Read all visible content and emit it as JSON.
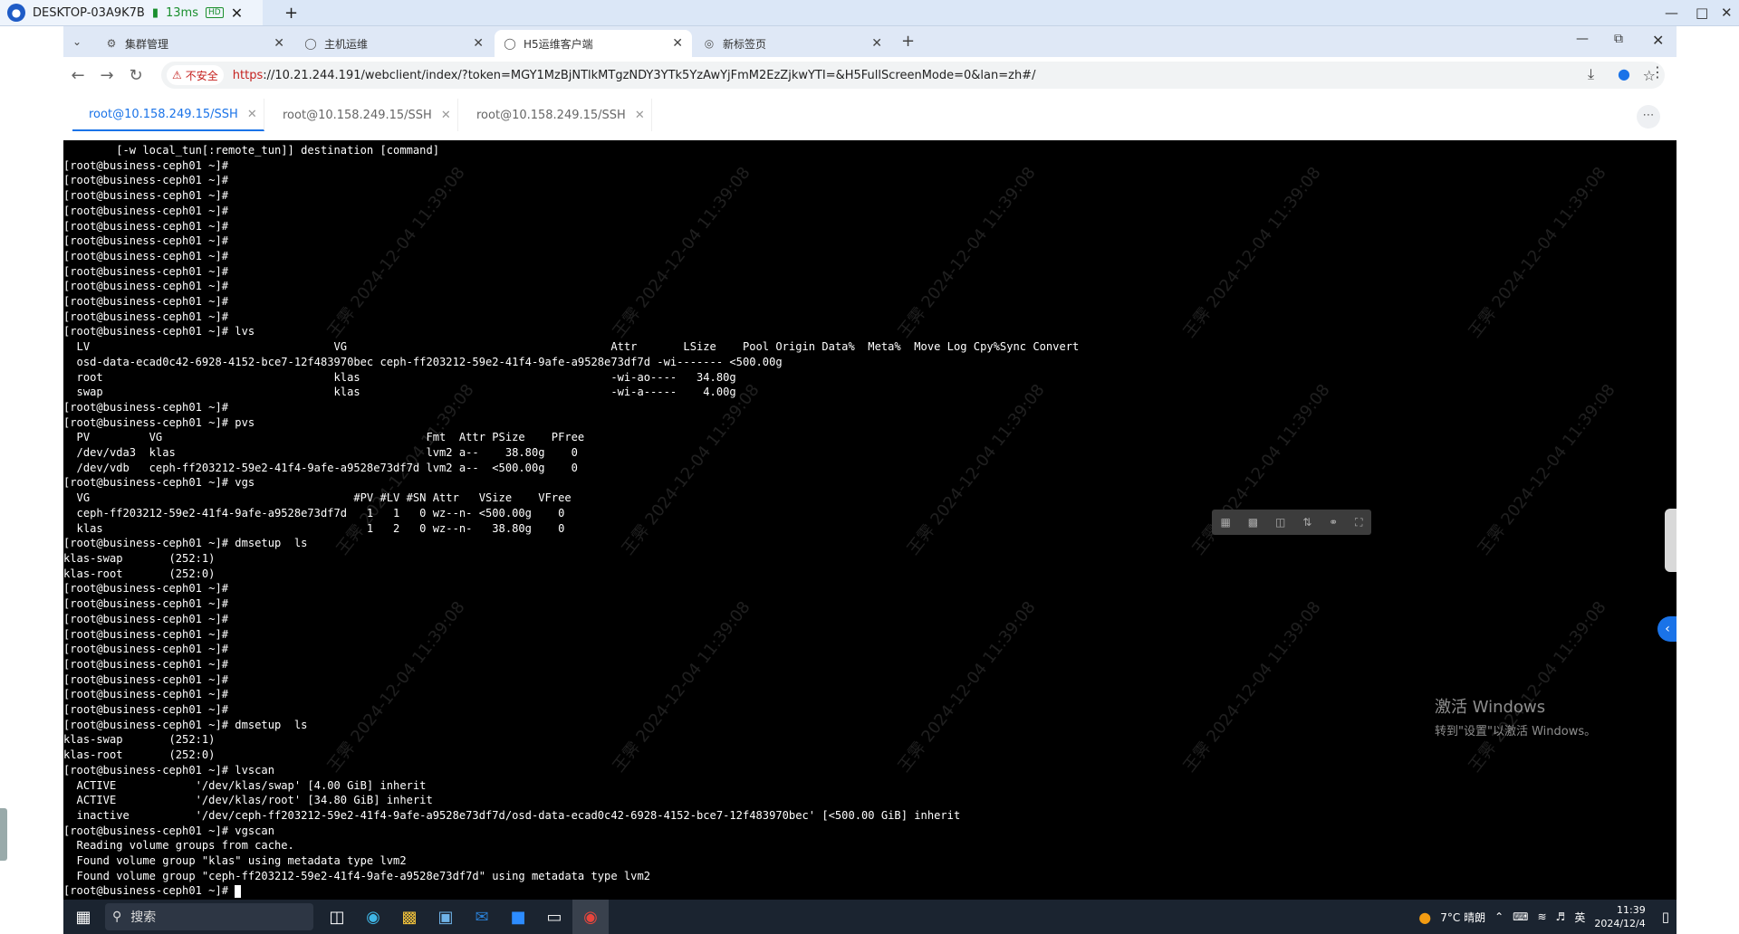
{
  "rdp": {
    "host": "DESKTOP-03A9K7B",
    "latency": "13ms",
    "hd_badge": "HD"
  },
  "browser": {
    "tabs": [
      {
        "label": "集群管理"
      },
      {
        "label": "主机运维"
      },
      {
        "label": "H5运维客户端"
      },
      {
        "label": "新标签页"
      }
    ],
    "security_label": "不安全",
    "url_scheme": "https",
    "url_rest": "://10.21.244.191/webclient/index/?token=MGY1MzBjNTlkMTgzNDY3YTk5YzAwYjFmM2EzZjkwYTI=&H5FullScreenMode=0&lan=zh#/"
  },
  "ssh_tabs": [
    {
      "label": "root@10.158.249.15/SSH"
    },
    {
      "label": "root@10.158.249.15/SSH"
    },
    {
      "label": "root@10.158.249.15/SSH"
    }
  ],
  "terminal": {
    "lines": "        [-w local_tun[:remote_tun]] destination [command]\n[root@business-ceph01 ~]#\n[root@business-ceph01 ~]#\n[root@business-ceph01 ~]#\n[root@business-ceph01 ~]#\n[root@business-ceph01 ~]#\n[root@business-ceph01 ~]#\n[root@business-ceph01 ~]#\n[root@business-ceph01 ~]#\n[root@business-ceph01 ~]#\n[root@business-ceph01 ~]#\n[root@business-ceph01 ~]#\n[root@business-ceph01 ~]# lvs\n  LV                                     VG                                        Attr       LSize    Pool Origin Data%  Meta%  Move Log Cpy%Sync Convert\n  osd-data-ecad0c42-6928-4152-bce7-12f483970bec ceph-ff203212-59e2-41f4-9afe-a9528e73df7d -wi------- <500.00g\n  root                                   klas                                      -wi-ao----   34.80g\n  swap                                   klas                                      -wi-a-----    4.00g\n[root@business-ceph01 ~]#\n[root@business-ceph01 ~]# pvs\n  PV         VG                                        Fmt  Attr PSize    PFree\n  /dev/vda3  klas                                      lvm2 a--    38.80g    0\n  /dev/vdb   ceph-ff203212-59e2-41f4-9afe-a9528e73df7d lvm2 a--  <500.00g    0\n[root@business-ceph01 ~]# vgs\n  VG                                        #PV #LV #SN Attr   VSize    VFree\n  ceph-ff203212-59e2-41f4-9afe-a9528e73df7d   1   1   0 wz--n- <500.00g    0\n  klas                                        1   2   0 wz--n-   38.80g    0\n[root@business-ceph01 ~]# dmsetup  ls\nklas-swap       (252:1)\nklas-root       (252:0)\n[root@business-ceph01 ~]#\n[root@business-ceph01 ~]#\n[root@business-ceph01 ~]#\n[root@business-ceph01 ~]#\n[root@business-ceph01 ~]#\n[root@business-ceph01 ~]#\n[root@business-ceph01 ~]#\n[root@business-ceph01 ~]#\n[root@business-ceph01 ~]#\n[root@business-ceph01 ~]# dmsetup  ls\nklas-swap       (252:1)\nklas-root       (252:0)\n[root@business-ceph01 ~]# lvscan\n  ACTIVE            '/dev/klas/swap' [4.00 GiB] inherit\n  ACTIVE            '/dev/klas/root' [34.80 GiB] inherit\n  inactive          '/dev/ceph-ff203212-59e2-41f4-9afe-a9528e73df7d/osd-data-ecad0c42-6928-4152-bce7-12f483970bec' [<500.00 GiB] inherit\n[root@business-ceph01 ~]# vgscan\n  Reading volume groups from cache.\n  Found volume group \"klas\" using metadata type lvm2\n  Found volume group \"ceph-ff203212-59e2-41f4-9afe-a9528e73df7d\" using metadata type lvm2\n[root@business-ceph01 ~]# ",
    "watermark_name": "王霁",
    "watermark_time": "2024-12-04 11:39:08"
  },
  "activation": {
    "title": "激活 Windows",
    "subtitle": "转到\"设置\"以激活 Windows。"
  },
  "taskbar": {
    "search_label": "搜索",
    "weather": "7°C  晴朗",
    "ime": "英",
    "time": "11:39",
    "date": "2024/12/4"
  }
}
